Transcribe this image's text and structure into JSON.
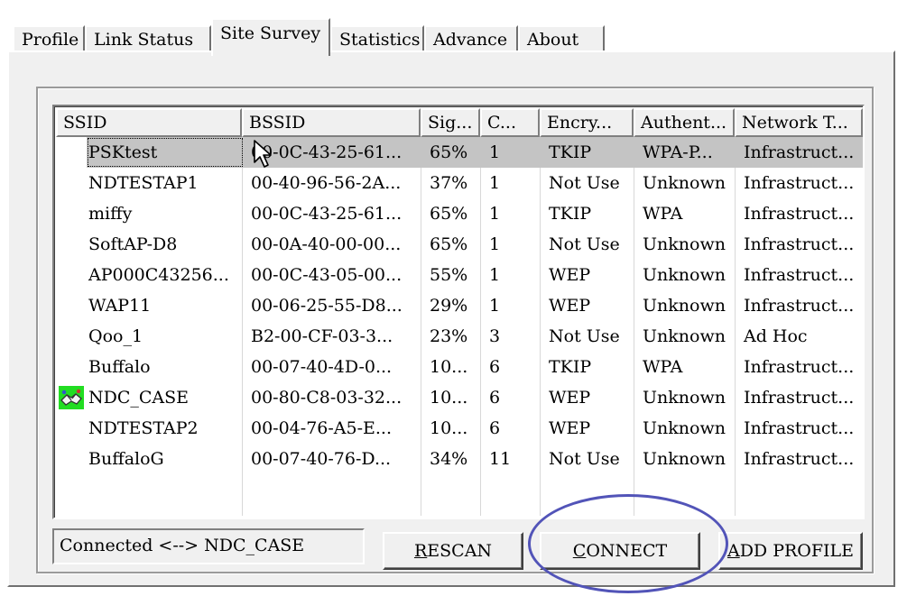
{
  "tabs": [
    {
      "label": "Profile"
    },
    {
      "label": "Link Status"
    },
    {
      "label": "Site Survey",
      "active": true
    },
    {
      "label": "Statistics"
    },
    {
      "label": "Advance"
    },
    {
      "label": "About"
    }
  ],
  "table": {
    "columns": [
      "SSID",
      "BSSID",
      "Sig...",
      "C...",
      "Encry...",
      "Authent...",
      "Network T..."
    ],
    "rows": [
      {
        "ssid": "PSKtest",
        "bssid": "00-0C-43-25-61...",
        "signal": "65%",
        "channel": "1",
        "encryption": "TKIP",
        "auth": "WPA-P...",
        "network": "Infrastruct...",
        "selected": true
      },
      {
        "ssid": "NDTESTAP1",
        "bssid": "00-40-96-56-2A...",
        "signal": "37%",
        "channel": "1",
        "encryption": "Not Use",
        "auth": "Unknown",
        "network": "Infrastruct..."
      },
      {
        "ssid": "miffy",
        "bssid": "00-0C-43-25-61...",
        "signal": "65%",
        "channel": "1",
        "encryption": "TKIP",
        "auth": "WPA",
        "network": "Infrastruct..."
      },
      {
        "ssid": "SoftAP-D8",
        "bssid": "00-0A-40-00-00...",
        "signal": "65%",
        "channel": "1",
        "encryption": "Not Use",
        "auth": "Unknown",
        "network": "Infrastruct..."
      },
      {
        "ssid": "AP000C43256...",
        "bssid": "00-0C-43-05-00...",
        "signal": "55%",
        "channel": "1",
        "encryption": "WEP",
        "auth": "Unknown",
        "network": "Infrastruct..."
      },
      {
        "ssid": "WAP11",
        "bssid": "00-06-25-55-D8...",
        "signal": "29%",
        "channel": "1",
        "encryption": "WEP",
        "auth": "Unknown",
        "network": "Infrastruct..."
      },
      {
        "ssid": "Qoo_1",
        "bssid": "B2-00-CF-03-3...",
        "signal": "23%",
        "channel": "3",
        "encryption": "Not Use",
        "auth": "Unknown",
        "network": "Ad Hoc"
      },
      {
        "ssid": "Buffalo",
        "bssid": "00-07-40-4D-0...",
        "signal": "10...",
        "channel": "6",
        "encryption": "TKIP",
        "auth": "WPA",
        "network": "Infrastruct..."
      },
      {
        "ssid": "NDC_CASE",
        "bssid": "00-80-C8-03-32...",
        "signal": "10...",
        "channel": "6",
        "encryption": "WEP",
        "auth": "Unknown",
        "network": "Infrastruct...",
        "connected": true
      },
      {
        "ssid": "NDTESTAP2",
        "bssid": "00-04-76-A5-E...",
        "signal": "10...",
        "channel": "6",
        "encryption": "WEP",
        "auth": "Unknown",
        "network": "Infrastruct..."
      },
      {
        "ssid": "BuffaloG",
        "bssid": "00-07-40-76-D...",
        "signal": "34%",
        "channel": "11",
        "encryption": "Not Use",
        "auth": "Unknown",
        "network": "Infrastruct..."
      }
    ]
  },
  "status": {
    "text": "Connected <--> NDC_CASE"
  },
  "buttons": {
    "rescan": {
      "mnemonic": "R",
      "rest": "ESCAN"
    },
    "connect": {
      "mnemonic": "C",
      "rest": "ONNECT"
    },
    "add_profile": {
      "mnemonic": "A",
      "rest": "DD PROFILE"
    }
  },
  "colors": {
    "highlight_ring": "#5254b8",
    "connected_icon_bg": "#22dd22",
    "selection": "#c4c4c4"
  },
  "icons": {
    "connected": "handshake-icon",
    "pointer": "mouse-pointer-icon"
  }
}
